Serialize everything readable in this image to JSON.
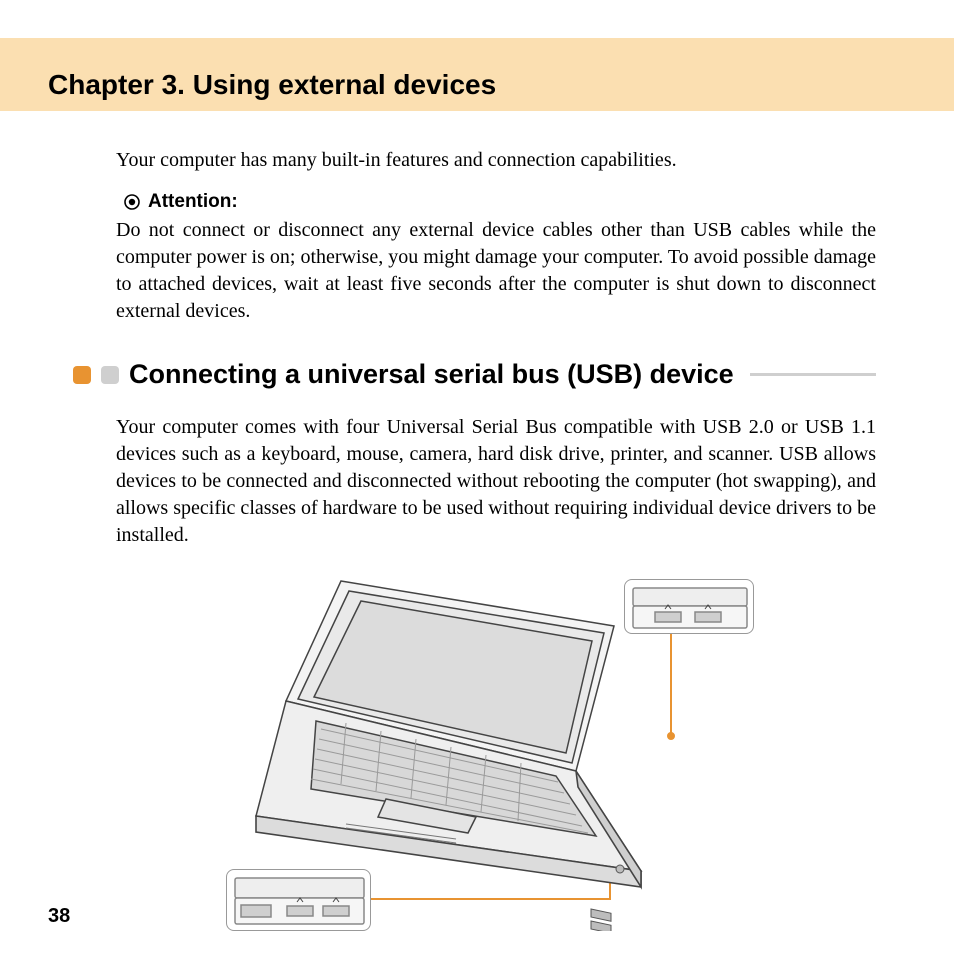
{
  "chapter": {
    "title": "Chapter 3. Using external devices"
  },
  "intro": "Your computer has many built-in features and connection capabilities.",
  "attention": {
    "label": "Attention:",
    "text": "Do not connect or disconnect any external device cables other than USB cables while the computer power is on; otherwise, you might damage your computer. To avoid possible damage to attached devices, wait at least five seconds after the computer is shut down to disconnect external devices."
  },
  "section": {
    "title": "Connecting a universal serial bus (USB) device",
    "text": "Your computer comes with four Universal Serial Bus compatible with USB 2.0 or USB 1.1 devices such as a keyboard, mouse, camera, hard disk drive, printer, and scanner. USB allows devices to be connected and disconnected without rebooting the computer (hot swapping), and allows specific classes of hardware to be used without requiring individual device drivers to be installed."
  },
  "page_number": "38"
}
